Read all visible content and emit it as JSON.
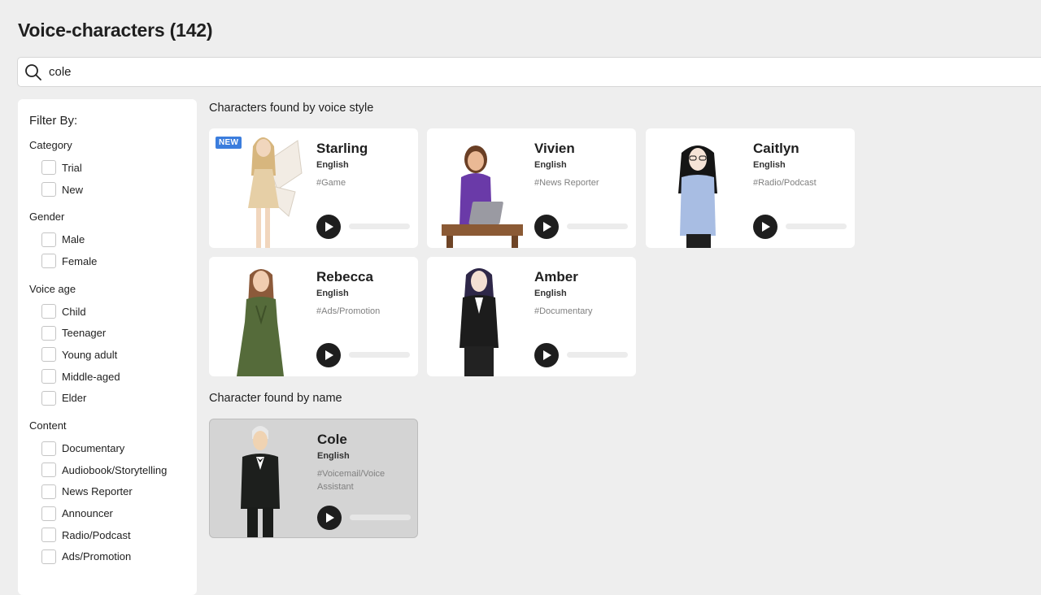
{
  "header": {
    "title": "Voice-characters (142)"
  },
  "search": {
    "value": "cole",
    "icon": "search-icon"
  },
  "filters": {
    "title": "Filter By:",
    "groups": [
      {
        "title": "Category",
        "options": [
          "Trial",
          "New"
        ]
      },
      {
        "title": "Gender",
        "options": [
          "Male",
          "Female"
        ]
      },
      {
        "title": "Voice age",
        "options": [
          "Child",
          "Teenager",
          "Young adult",
          "Middle-aged",
          "Elder"
        ]
      },
      {
        "title": "Content",
        "options": [
          "Documentary",
          "Audiobook/Storytelling",
          "News Reporter",
          "Announcer",
          "Radio/Podcast",
          "Ads/Promotion"
        ]
      }
    ]
  },
  "sections": {
    "by_style": "Characters found by voice style",
    "by_name": "Character found by name"
  },
  "characters": [
    {
      "name": "Starling",
      "language": "English",
      "tag": "#Game",
      "badge": "NEW"
    },
    {
      "name": "Vivien",
      "language": "English",
      "tag": "#News Reporter"
    },
    {
      "name": "Caitlyn",
      "language": "English",
      "tag": "#Radio/Podcast"
    },
    {
      "name": "Rebecca",
      "language": "English",
      "tag": "#Ads/Promotion"
    },
    {
      "name": "Amber",
      "language": "English",
      "tag": "#Documentary"
    }
  ],
  "name_match": {
    "name": "Cole",
    "language": "English",
    "tag": "#Voicemail/Voice Assistant"
  },
  "colors": {
    "badge": "#3b7ddd",
    "play_button": "#1e1e1e",
    "background": "#eeeeee"
  }
}
